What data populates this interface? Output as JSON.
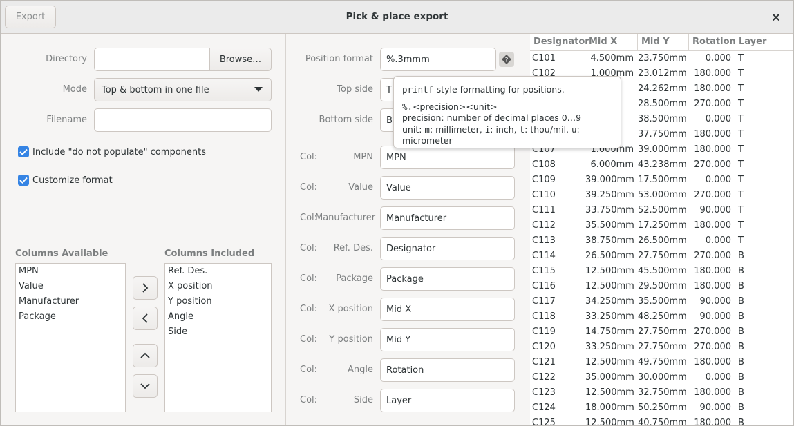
{
  "window": {
    "title": "Pick & place export",
    "export_label": "Export",
    "close_icon": "close-icon"
  },
  "left": {
    "directory_label": "Directory",
    "directory_value": "",
    "browse_label": "Browse…",
    "mode_label": "Mode",
    "mode_value": "Top & bottom in one file",
    "filename_label": "Filename",
    "filename_value": "",
    "include_dnp_label": "Include \"do not populate\" components",
    "customize_label": "Customize format",
    "available_title": "Columns Available",
    "available": [
      "MPN",
      "Value",
      "Manufacturer",
      "Package"
    ],
    "included_title": "Columns Included",
    "included": [
      "Ref. Des.",
      "X position",
      "Y position",
      "Angle",
      "Side"
    ]
  },
  "middle": {
    "position_format_label": "Position format",
    "position_format_value": "%.3mmm",
    "top_side_label": "Top side",
    "top_side_value": "T",
    "bottom_side_label": "Bottom side",
    "bottom_side_value": "B",
    "col_prefix": "Col:",
    "columns": [
      {
        "name": "MPN",
        "value": "MPN"
      },
      {
        "name": "Value",
        "value": "Value"
      },
      {
        "name": "Manufacturer",
        "value": "Manufacturer"
      },
      {
        "name": "Ref. Des.",
        "value": "Designator"
      },
      {
        "name": "Package",
        "value": "Package"
      },
      {
        "name": "X position",
        "value": "Mid X"
      },
      {
        "name": "Y position",
        "value": "Mid Y"
      },
      {
        "name": "Angle",
        "value": "Rotation"
      },
      {
        "name": "Side",
        "value": "Layer"
      }
    ]
  },
  "tooltip": {
    "line1_code": "printf",
    "line1_rest": "-style formatting for positions.",
    "line2_code": "%.",
    "line2_rest": "<precision><unit>",
    "line3": "precision: number of decimal places 0…9",
    "line4_a": "unit: ",
    "line4_m": "m",
    "line4_b": ": millimeter, ",
    "line4_i": "i",
    "line4_c": ": inch, ",
    "line4_t": "t",
    "line4_d": ": thou/mil, ",
    "line4_u": "u",
    "line4_e": ": micrometer"
  },
  "table": {
    "headers": [
      "Designator",
      "Mid X",
      "Mid Y",
      "Rotation",
      "Layer"
    ],
    "rows": [
      [
        "C101",
        "4.500mm",
        "23.750mm",
        "0.000",
        "T"
      ],
      [
        "C102",
        "1.000mm",
        "23.012mm",
        "180.000",
        "T"
      ],
      [
        "C103",
        "",
        "24.262mm",
        "180.000",
        "T"
      ],
      [
        "C104",
        "",
        "28.500mm",
        "270.000",
        "T"
      ],
      [
        "C105",
        "",
        "38.500mm",
        "0.000",
        "T"
      ],
      [
        "C106",
        "",
        "37.750mm",
        "180.000",
        "T"
      ],
      [
        "C107",
        "1.000mm",
        "39.000mm",
        "180.000",
        "T"
      ],
      [
        "C108",
        "6.000mm",
        "43.238mm",
        "270.000",
        "T"
      ],
      [
        "C109",
        "39.000mm",
        "17.500mm",
        "0.000",
        "T"
      ],
      [
        "C110",
        "39.250mm",
        "53.000mm",
        "270.000",
        "T"
      ],
      [
        "C111",
        "33.750mm",
        "52.500mm",
        "90.000",
        "T"
      ],
      [
        "C112",
        "35.500mm",
        "17.250mm",
        "180.000",
        "T"
      ],
      [
        "C113",
        "38.750mm",
        "26.500mm",
        "0.000",
        "T"
      ],
      [
        "C114",
        "26.500mm",
        "27.750mm",
        "270.000",
        "B"
      ],
      [
        "C115",
        "12.500mm",
        "45.500mm",
        "180.000",
        "B"
      ],
      [
        "C116",
        "12.500mm",
        "29.500mm",
        "180.000",
        "B"
      ],
      [
        "C117",
        "34.250mm",
        "35.500mm",
        "90.000",
        "B"
      ],
      [
        "C118",
        "33.250mm",
        "48.250mm",
        "90.000",
        "B"
      ],
      [
        "C119",
        "14.750mm",
        "27.750mm",
        "270.000",
        "B"
      ],
      [
        "C120",
        "33.250mm",
        "27.750mm",
        "270.000",
        "B"
      ],
      [
        "C121",
        "12.500mm",
        "49.750mm",
        "180.000",
        "B"
      ],
      [
        "C122",
        "35.000mm",
        "30.000mm",
        "0.000",
        "B"
      ],
      [
        "C123",
        "12.500mm",
        "32.750mm",
        "180.000",
        "B"
      ],
      [
        "C124",
        "18.000mm",
        "50.250mm",
        "90.000",
        "B"
      ],
      [
        "C125",
        "12.500mm",
        "40.750mm",
        "180.000",
        "B"
      ]
    ]
  },
  "colors": {
    "accent": "#3584e4"
  }
}
